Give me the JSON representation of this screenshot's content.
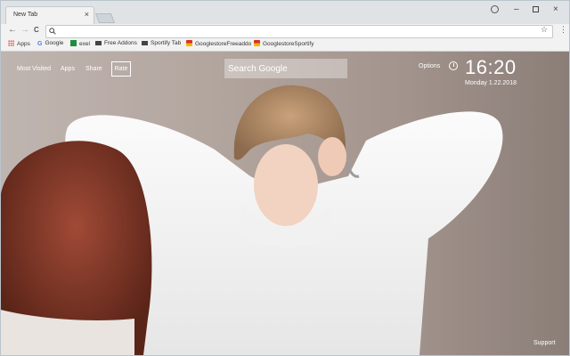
{
  "window": {
    "tab_title": "New Tab",
    "tab_close": "×",
    "minimize": "–",
    "close": "×"
  },
  "toolbar": {
    "back": "←",
    "forward": "→",
    "reload": "C",
    "address_value": "",
    "star": "☆",
    "menu": "⋮"
  },
  "bookmarks": {
    "items": [
      {
        "label": "Apps",
        "icon": "apps-grid-icon",
        "color": "#e04b3a"
      },
      {
        "label": "Google",
        "icon": "google-g-icon",
        "color": "#4285f4"
      },
      {
        "label": "exel",
        "icon": "sheets-icon",
        "color": "#1e8e3e"
      },
      {
        "label": "Free Addons",
        "icon": "addon-box-icon",
        "color": "#333333"
      },
      {
        "label": "Sportify Tab",
        "icon": "addon-box-icon",
        "color": "#333333"
      },
      {
        "label": "GooglestoreFreeaddo",
        "icon": "store-bag-icon",
        "color": "#d93025"
      },
      {
        "label": "GooglestoreSportify",
        "icon": "store-bag-icon",
        "color": "#d93025"
      }
    ]
  },
  "newtab": {
    "nav": {
      "most_visited": "Most Visited",
      "apps": "Apps",
      "share": "Share",
      "rate": "Rate"
    },
    "search_placeholder": "Search Google",
    "options": "Options",
    "time": "16:20",
    "date": "Monday  1.22.2018",
    "support": "Support"
  }
}
